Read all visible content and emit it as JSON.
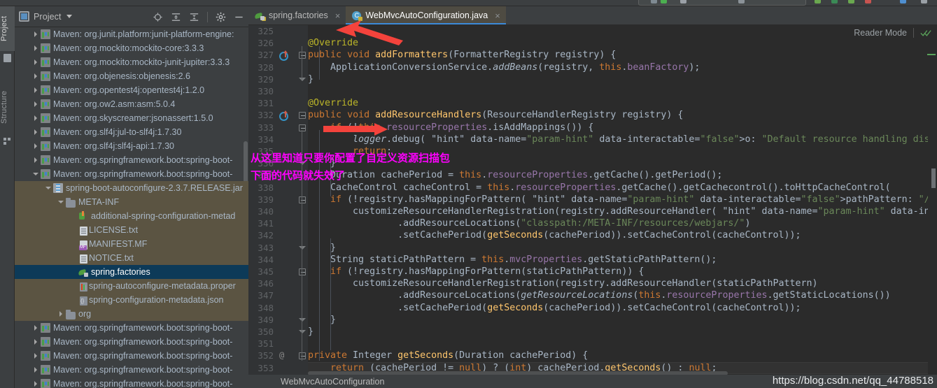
{
  "window": {
    "theme_bg": "#3c3f41",
    "editor_bg": "#2b2b2b",
    "accent": "#3b8ad8"
  },
  "left_tool_strip": {
    "tabs": [
      {
        "label": "Project",
        "selected": true,
        "icon": "project-icon"
      },
      {
        "label": "Structure",
        "selected": false,
        "icon": "structure-icon"
      }
    ]
  },
  "project_panel": {
    "title": "Project",
    "title_icon": "project-window-icon",
    "dropdown_icon": "chevron-down-icon",
    "toolbar": [
      {
        "name": "locate-icon",
        "title": "Select Opened File"
      },
      {
        "name": "expand-all-icon",
        "title": "Expand All"
      },
      {
        "name": "collapse-all-icon",
        "title": "Collapse All"
      },
      {
        "name": "gear-icon",
        "title": "Settings"
      },
      {
        "name": "hide-icon",
        "title": "Hide"
      }
    ],
    "tree": [
      {
        "label": "Maven: org.junit.platform:junit-platform-engine:",
        "indent": 1,
        "arrow": "right",
        "icon": "maven-icon",
        "state": "normal"
      },
      {
        "label": "Maven: org.mockito:mockito-core:3.3.3",
        "indent": 1,
        "arrow": "right",
        "icon": "maven-icon",
        "state": "normal"
      },
      {
        "label": "Maven: org.mockito:mockito-junit-jupiter:3.3.3",
        "indent": 1,
        "arrow": "right",
        "icon": "maven-icon",
        "state": "normal"
      },
      {
        "label": "Maven: org.objenesis:objenesis:2.6",
        "indent": 1,
        "arrow": "right",
        "icon": "maven-icon",
        "state": "normal"
      },
      {
        "label": "Maven: org.opentest4j:opentest4j:1.2.0",
        "indent": 1,
        "arrow": "right",
        "icon": "maven-icon",
        "state": "normal"
      },
      {
        "label": "Maven: org.ow2.asm:asm:5.0.4",
        "indent": 1,
        "arrow": "right",
        "icon": "maven-icon",
        "state": "normal"
      },
      {
        "label": "Maven: org.skyscreamer:jsonassert:1.5.0",
        "indent": 1,
        "arrow": "right",
        "icon": "maven-icon",
        "state": "normal"
      },
      {
        "label": "Maven: org.slf4j:jul-to-slf4j:1.7.30",
        "indent": 1,
        "arrow": "right",
        "icon": "maven-icon",
        "state": "normal"
      },
      {
        "label": "Maven: org.slf4j:slf4j-api:1.7.30",
        "indent": 1,
        "arrow": "right",
        "icon": "maven-icon",
        "state": "normal"
      },
      {
        "label": "Maven: org.springframework.boot:spring-boot-",
        "indent": 1,
        "arrow": "right",
        "icon": "maven-icon",
        "state": "normal"
      },
      {
        "label": "Maven: org.springframework.boot:spring-boot-",
        "indent": 1,
        "arrow": "down",
        "icon": "maven-icon",
        "state": "normal"
      },
      {
        "label": "spring-boot-autoconfigure-2.3.7.RELEASE.jar",
        "indent": 2,
        "arrow": "down",
        "icon": "jar-icon",
        "state": "open-path"
      },
      {
        "label": "META-INF",
        "indent": 3,
        "arrow": "down",
        "icon": "folder-icon",
        "state": "open-path"
      },
      {
        "label": "additional-spring-configuration-metad",
        "indent": 4,
        "arrow": "none",
        "icon": "additional-metadata-icon",
        "state": "open-path"
      },
      {
        "label": "LICENSE.txt",
        "indent": 4,
        "arrow": "none",
        "icon": "text-file-icon",
        "state": "open-path"
      },
      {
        "label": "MANIFEST.MF",
        "indent": 4,
        "arrow": "none",
        "icon": "manifest-icon",
        "state": "open-path"
      },
      {
        "label": "NOTICE.txt",
        "indent": 4,
        "arrow": "none",
        "icon": "text-file-icon",
        "state": "open-path"
      },
      {
        "label": "spring.factories",
        "indent": 4,
        "arrow": "none",
        "icon": "spring-leaf-icon",
        "state": "selected"
      },
      {
        "label": "spring-autoconfigure-metadata.proper",
        "indent": 4,
        "arrow": "none",
        "icon": "properties-icon",
        "state": "open-path"
      },
      {
        "label": "spring-configuration-metadata.json",
        "indent": 4,
        "arrow": "none",
        "icon": "json-icon",
        "state": "open-path"
      },
      {
        "label": "org",
        "indent": 3,
        "arrow": "right",
        "icon": "folder-icon",
        "state": "open-path"
      },
      {
        "label": "Maven: org.springframework.boot:spring-boot-",
        "indent": 1,
        "arrow": "right",
        "icon": "maven-icon",
        "state": "normal"
      },
      {
        "label": "Maven: org.springframework.boot:spring-boot-",
        "indent": 1,
        "arrow": "right",
        "icon": "maven-icon",
        "state": "normal"
      },
      {
        "label": "Maven: org.springframework.boot:spring-boot-",
        "indent": 1,
        "arrow": "right",
        "icon": "maven-icon",
        "state": "normal"
      },
      {
        "label": "Maven: org.springframework.boot:spring-boot-",
        "indent": 1,
        "arrow": "right",
        "icon": "maven-icon",
        "state": "normal"
      },
      {
        "label": "Maven: org.springframework.boot:spring-boot-",
        "indent": 1,
        "arrow": "right",
        "icon": "maven-icon",
        "state": "normal"
      }
    ]
  },
  "editor": {
    "tabs": [
      {
        "label": "spring.factories",
        "icon": "spring-leaf-icon",
        "active": false,
        "close_glyph": "×"
      },
      {
        "label": "WebMvcAutoConfiguration.java",
        "icon": "java-class-icon",
        "active": true,
        "close_glyph": "×"
      }
    ],
    "reader_mode": {
      "label": "Reader Mode",
      "check_icon": "double-check-icon"
    },
    "breadcrumb": "WebMvcAutoConfiguration",
    "first_line_number": 325,
    "lines": [
      {
        "n": 325,
        "text": ""
      },
      {
        "n": 326,
        "text": "@Override"
      },
      {
        "n": 327,
        "text": "public void addFormatters(FormatterRegistry registry) {"
      },
      {
        "n": 328,
        "text": "    ApplicationConversionService.addBeans(registry, this.beanFactory);"
      },
      {
        "n": 329,
        "text": "}"
      },
      {
        "n": 330,
        "text": ""
      },
      {
        "n": 331,
        "text": "@Override"
      },
      {
        "n": 332,
        "text": "public void addResourceHandlers(ResourceHandlerRegistry registry) {"
      },
      {
        "n": 333,
        "text": "    if (!this.resourceProperties.isAddMappings()) {"
      },
      {
        "n": 334,
        "text": "        logger.debug( o: \"Default resource handling disabled\");"
      },
      {
        "n": 335,
        "text": "        return;"
      },
      {
        "n": 336,
        "text": "    }"
      },
      {
        "n": 337,
        "text": "    Duration cachePeriod = this.resourceProperties.getCache().getPeriod();"
      },
      {
        "n": 338,
        "text": "    CacheControl cacheControl = this.resourceProperties.getCache().getCachecontrol().toHttpCacheControl("
      },
      {
        "n": 339,
        "text": "    if (!registry.hasMappingForPattern( pathPattern: \"/webjars/**\")) {"
      },
      {
        "n": 340,
        "text": "        customizeResourceHandlerRegistration(registry.addResourceHandler( ...pathPatterns: \"/webjars/**\")"
      },
      {
        "n": 341,
        "text": "                .addResourceLocations(\"classpath:/META-INF/resources/webjars/\")"
      },
      {
        "n": 342,
        "text": "                .setCachePeriod(getSeconds(cachePeriod)).setCacheControl(cacheControl));"
      },
      {
        "n": 343,
        "text": "    }"
      },
      {
        "n": 344,
        "text": "    String staticPathPattern = this.mvcProperties.getStaticPathPattern();"
      },
      {
        "n": 345,
        "text": "    if (!registry.hasMappingForPattern(staticPathPattern)) {"
      },
      {
        "n": 346,
        "text": "        customizeResourceHandlerRegistration(registry.addResourceHandler(staticPathPattern)"
      },
      {
        "n": 347,
        "text": "                .addResourceLocations(getResourceLocations(this.resourceProperties.getStaticLocations())"
      },
      {
        "n": 348,
        "text": "                .setCachePeriod(getSeconds(cachePeriod)).setCacheControl(cacheControl));"
      },
      {
        "n": 349,
        "text": "    }"
      },
      {
        "n": 350,
        "text": "}"
      },
      {
        "n": 351,
        "text": ""
      },
      {
        "n": 352,
        "text": "private Integer getSeconds(Duration cachePeriod) {"
      },
      {
        "n": 353,
        "text": "    return (cachePeriod != null) ? (int) cachePeriod.getSeconds() : null;"
      }
    ],
    "gutter_markers": [
      {
        "line": 327,
        "type": "implementing-method-icon"
      },
      {
        "line": 332,
        "type": "implementing-method-icon"
      },
      {
        "line": 352,
        "type": "annotation-marker",
        "glyph": "@"
      }
    ]
  },
  "annotations": {
    "chinese_note_line1": "从这里知道只要你配置了自定义资源扫描包",
    "chinese_note_line2": "下面的代码就失效了",
    "arrow_color": "#f4433c",
    "note_color": "#ff00ff",
    "arrows": [
      {
        "name": "arrow-to-active-tab"
      },
      {
        "name": "arrow-to-isaddmappings-line"
      }
    ]
  },
  "watermark": {
    "text": "https://blog.csdn.net/qq_44788518"
  }
}
